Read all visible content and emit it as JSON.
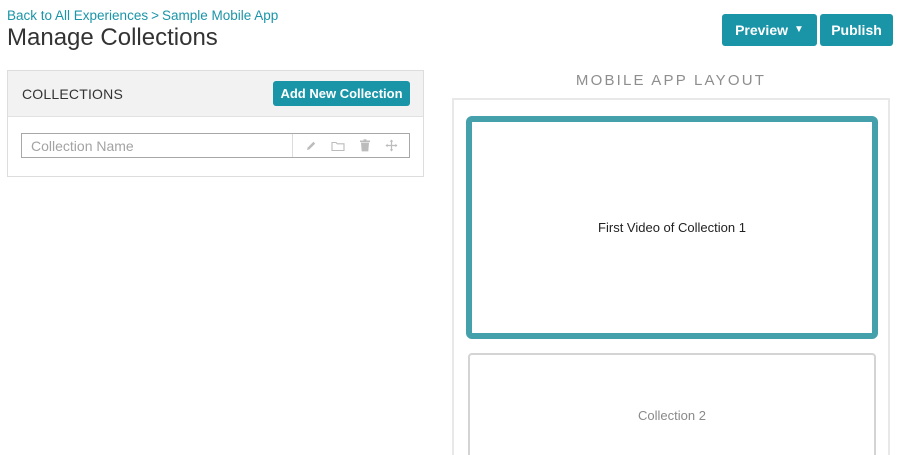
{
  "breadcrumb": {
    "back_label": "Back to All Experiences",
    "separator": ">",
    "current": "Sample Mobile App"
  },
  "page_title": "Manage Collections",
  "header_actions": {
    "preview_label": "Preview",
    "publish_label": "Publish"
  },
  "collections_panel": {
    "title": "COLLECTIONS",
    "add_button_label": "Add New Collection",
    "row": {
      "name_value": "",
      "name_placeholder": "Collection Name",
      "icons": [
        "pencil-icon",
        "folder-icon",
        "trash-icon",
        "move-icon"
      ]
    }
  },
  "mobile_layout": {
    "title": "MOBILE APP LAYOUT",
    "cards": [
      {
        "label": "First Video of Collection 1",
        "active": true
      },
      {
        "label": "Collection 2",
        "active": false
      }
    ]
  },
  "colors": {
    "accent": "#1a95a8",
    "active_border": "#44a0aa",
    "panel_header_bg": "#f2f2f2"
  }
}
